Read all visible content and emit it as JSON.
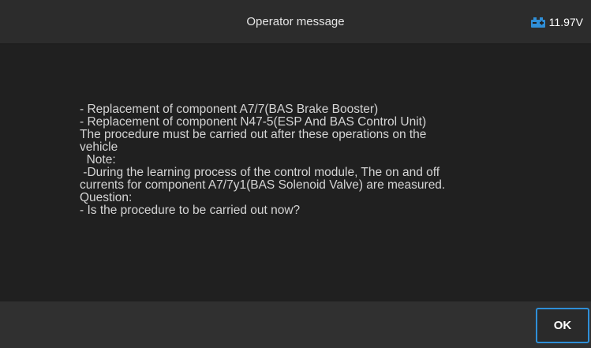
{
  "header": {
    "title": "Operator message",
    "voltage": "11.97V",
    "battery_icon": "car-battery-icon",
    "accent_color": "#2f8fd8"
  },
  "message": {
    "lines": [
      "- Replacement of component A7/7(BAS Brake Booster)",
      "- Replacement of component N47-5(ESP And BAS Control Unit)",
      "The procedure must be carried out after these operations on the",
      "vehicle",
      "  Note:",
      " -During the learning process of the control module, The on and off",
      "currents for component A7/7y1(BAS Solenoid Valve) are measured.",
      "Question:",
      "- Is the procedure to be carried out now?"
    ]
  },
  "footer": {
    "ok_label": "OK"
  }
}
